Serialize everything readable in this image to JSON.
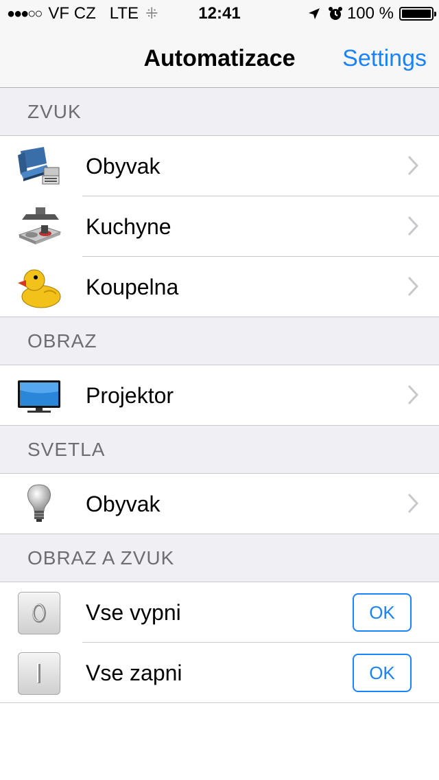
{
  "status_bar": {
    "signal": "●●●○○",
    "carrier": "VF CZ",
    "network": "LTE",
    "time": "12:41",
    "battery_percent": "100 %"
  },
  "nav": {
    "title": "Automatizace",
    "settings_label": "Settings"
  },
  "sections": [
    {
      "header": "ZVUK",
      "rows": [
        {
          "label": "Obyvak",
          "icon": "sofa-stereo-icon"
        },
        {
          "label": "Kuchyne",
          "icon": "kitchen-stove-icon"
        },
        {
          "label": "Koupelna",
          "icon": "rubber-duck-icon"
        }
      ]
    },
    {
      "header": "OBRAZ",
      "rows": [
        {
          "label": "Projektor",
          "icon": "tv-monitor-icon"
        }
      ]
    },
    {
      "header": "SVETLA",
      "rows": [
        {
          "label": "Obyvak",
          "icon": "light-bulb-icon"
        }
      ]
    },
    {
      "header": "OBRAZ A ZVUK",
      "rows": [
        {
          "label": "Vse vypni",
          "icon": "power-off-icon",
          "button": "OK"
        },
        {
          "label": "Vse zapni",
          "icon": "power-on-icon",
          "button": "OK"
        }
      ]
    }
  ],
  "colors": {
    "accent": "#1a82fb",
    "section_bg": "#efeff4",
    "section_text": "#6d6d72"
  }
}
